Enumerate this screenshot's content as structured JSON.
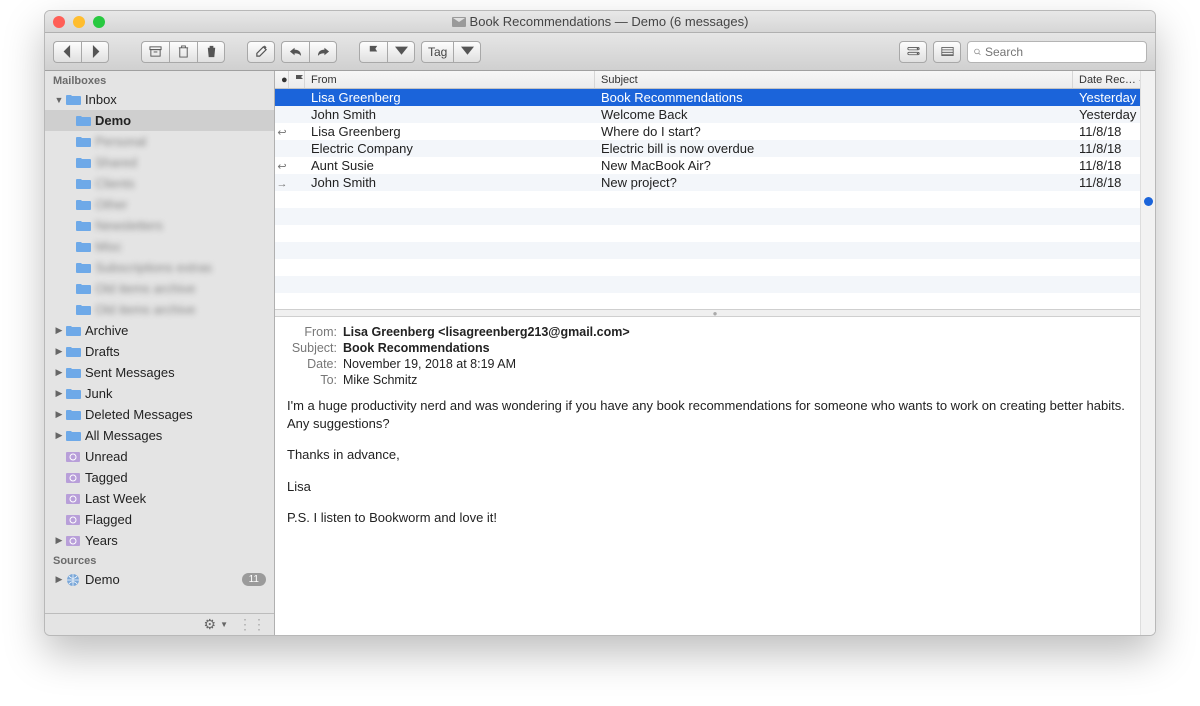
{
  "window": {
    "traffic": {
      "close": "#ff5f57",
      "min": "#ffbd2e",
      "max": "#28c940"
    },
    "title": "Book Recommendations — Demo (6 messages)"
  },
  "toolbar": {
    "tag_label": "Tag",
    "search_placeholder": "Search"
  },
  "sidebar": {
    "mailboxes_header": "Mailboxes",
    "inbox": {
      "label": "Inbox",
      "expanded": true
    },
    "inbox_children": [
      {
        "label": "Demo",
        "selected": true,
        "blur": false
      },
      {
        "label": "Personal",
        "blur": true
      },
      {
        "label": "Shared",
        "blur": true
      },
      {
        "label": "Clients",
        "blur": true
      },
      {
        "label": "Other",
        "blur": true
      },
      {
        "label": "Newsletters",
        "blur": true
      },
      {
        "label": "Misc",
        "blur": true
      },
      {
        "label": "Subscriptions extras",
        "blur": true
      },
      {
        "label": "Old items archive",
        "blur": true
      },
      {
        "label": "Old items archive",
        "blur": true
      }
    ],
    "folders": [
      {
        "label": "Archive"
      },
      {
        "label": "Drafts"
      },
      {
        "label": "Sent Messages"
      },
      {
        "label": "Junk"
      },
      {
        "label": "Deleted Messages"
      },
      {
        "label": "All Messages"
      }
    ],
    "smart": [
      {
        "label": "Unread"
      },
      {
        "label": "Tagged"
      },
      {
        "label": "Last Week"
      },
      {
        "label": "Flagged"
      },
      {
        "label": "Years",
        "hasChildren": true
      }
    ],
    "sources_header": "Sources",
    "sources": [
      {
        "label": "Demo",
        "badge": "11"
      }
    ],
    "gear": "⚙"
  },
  "columns": {
    "from": "From",
    "subject": "Subject",
    "date": "Date Rec…"
  },
  "messages": [
    {
      "indicator": "",
      "from": "Lisa Greenberg",
      "subject": "Book Recommendations",
      "date": "Yesterday",
      "selected": true
    },
    {
      "indicator": "",
      "from": "John Smith",
      "subject": "Welcome Back",
      "date": "Yesterday"
    },
    {
      "indicator": "↩",
      "from": "Lisa Greenberg",
      "subject": "Where do I start?",
      "date": "11/8/18"
    },
    {
      "indicator": "",
      "from": "Electric Company",
      "subject": "Electric bill is now overdue",
      "date": "11/8/18"
    },
    {
      "indicator": "↩",
      "from": "Aunt Susie",
      "subject": "New MacBook Air?",
      "date": "11/8/18"
    },
    {
      "indicator": "→",
      "from": "John Smith",
      "subject": "New project?",
      "date": "11/8/18"
    }
  ],
  "preview": {
    "labels": {
      "from": "From:",
      "subject": "Subject:",
      "date": "Date:",
      "to": "To:"
    },
    "from": "Lisa Greenberg <lisagreenberg213@gmail.com>",
    "subject": "Book Recommendations",
    "date": "November 19, 2018 at 8:19 AM",
    "to": "Mike Schmitz",
    "body": [
      "I'm a huge productivity nerd and was wondering if you have any book recommendations for someone who wants to work on creating better habits. Any suggestions?",
      "Thanks in advance,",
      "Lisa",
      "P.S. I listen to Bookworm and love it!"
    ]
  }
}
